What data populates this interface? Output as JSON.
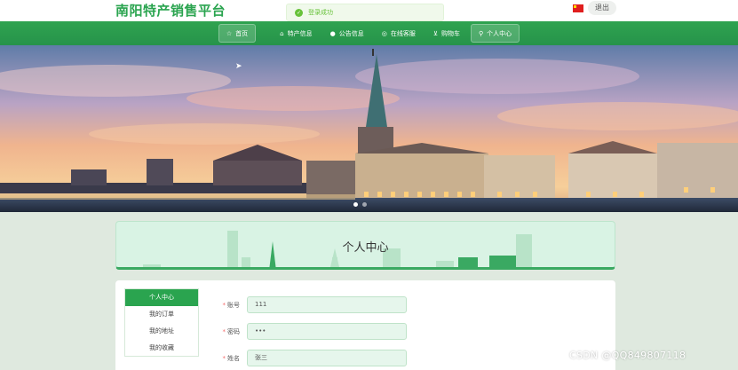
{
  "site": {
    "title": "南阳特产销售平台",
    "logout": "退出"
  },
  "toast": {
    "message": "登录成功"
  },
  "nav": {
    "items": [
      {
        "label": "首页",
        "icon": "star-icon"
      },
      {
        "label": "特产信息",
        "icon": "bag-icon"
      },
      {
        "label": "公告信息",
        "icon": "info-icon"
      },
      {
        "label": "在线客服",
        "icon": "headset-icon"
      },
      {
        "label": "购物车",
        "icon": "cart-icon"
      },
      {
        "label": "个人中心",
        "icon": "user-icon"
      }
    ],
    "active_index": 5
  },
  "banner": {
    "slide_count": 2,
    "active_slide": 0
  },
  "page": {
    "title": "个人中心"
  },
  "side_menu": {
    "items": [
      "个人中心",
      "我的订单",
      "我的地址",
      "我的收藏"
    ],
    "active_index": 0
  },
  "form": {
    "account": {
      "label": "账号",
      "value": "111"
    },
    "password": {
      "label": "密码",
      "value": "•••"
    },
    "name": {
      "label": "姓名",
      "value": "张三"
    }
  },
  "watermark": "CSDN @QQ849807118",
  "colors": {
    "primary": "#2aa44f",
    "nav": "#2b9c4d",
    "page_bg": "#dfe9df"
  }
}
